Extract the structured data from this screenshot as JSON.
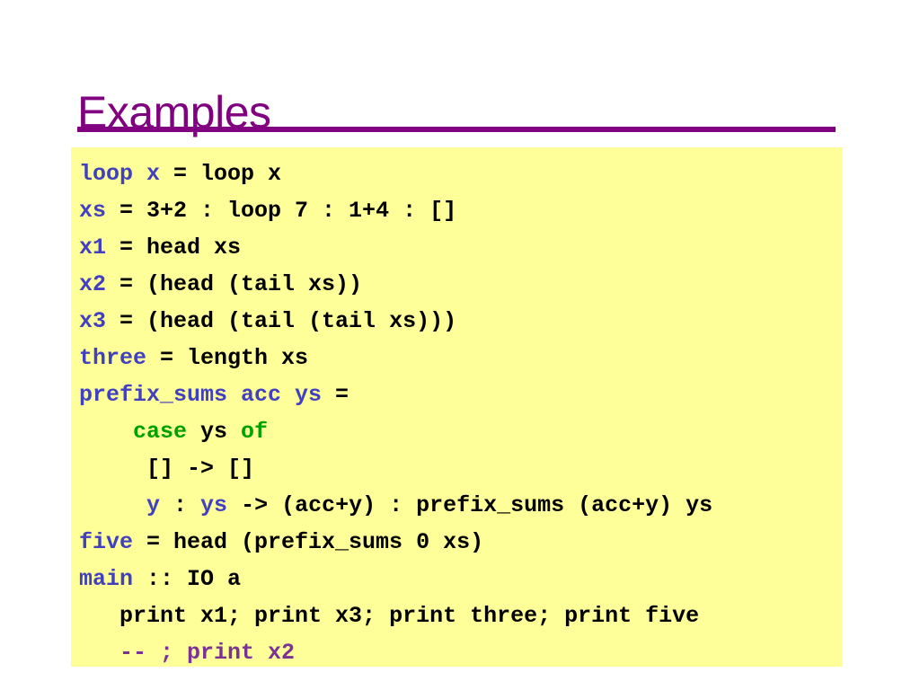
{
  "slide": {
    "title": "Examples",
    "accent_color": "#800080",
    "code_background": "#ffff99",
    "def_color": "#4040c0",
    "keyword_color": "#00a000",
    "comment_color": "#7b3294"
  },
  "code": {
    "lines": [
      {
        "indent": "",
        "tokens": [
          {
            "text": "loop x",
            "kind": "def"
          },
          {
            "text": " = loop x",
            "kind": "plain"
          }
        ]
      },
      {
        "indent": "",
        "tokens": [
          {
            "text": "xs",
            "kind": "def"
          },
          {
            "text": " = 3+2 : loop 7 : 1+4 : []",
            "kind": "plain"
          }
        ]
      },
      {
        "indent": "",
        "tokens": [
          {
            "text": "x1",
            "kind": "def"
          },
          {
            "text": " = head xs",
            "kind": "plain"
          }
        ]
      },
      {
        "indent": "",
        "tokens": [
          {
            "text": "x2",
            "kind": "def"
          },
          {
            "text": " = (head (tail xs))",
            "kind": "plain"
          }
        ]
      },
      {
        "indent": "",
        "tokens": [
          {
            "text": "x3",
            "kind": "def"
          },
          {
            "text": " = (head (tail (tail xs)))",
            "kind": "plain"
          }
        ]
      },
      {
        "indent": "",
        "tokens": [
          {
            "text": "three",
            "kind": "def"
          },
          {
            "text": " = length xs",
            "kind": "plain"
          }
        ]
      },
      {
        "indent": "",
        "tokens": [
          {
            "text": "prefix_sums acc ys",
            "kind": "def"
          },
          {
            "text": " =",
            "kind": "plain"
          }
        ]
      },
      {
        "indent": "    ",
        "tokens": [
          {
            "text": "case",
            "kind": "keyword"
          },
          {
            "text": " ys ",
            "kind": "plain"
          },
          {
            "text": "of",
            "kind": "keyword"
          }
        ]
      },
      {
        "indent": "     ",
        "tokens": [
          {
            "text": "[] -> []",
            "kind": "plain"
          }
        ]
      },
      {
        "indent": "     ",
        "tokens": [
          {
            "text": "y",
            "kind": "def"
          },
          {
            "text": " : ",
            "kind": "plain"
          },
          {
            "text": "ys",
            "kind": "def"
          },
          {
            "text": " -> (acc+y) : prefix_sums (acc+y) ys",
            "kind": "plain"
          }
        ]
      },
      {
        "indent": "",
        "tokens": [
          {
            "text": "five",
            "kind": "def"
          },
          {
            "text": " = head (prefix_sums 0 xs)",
            "kind": "plain"
          }
        ]
      },
      {
        "indent": "",
        "tokens": [
          {
            "text": "main",
            "kind": "def"
          },
          {
            "text": " :: IO a",
            "kind": "plain"
          }
        ]
      },
      {
        "indent": "   ",
        "tokens": [
          {
            "text": "print x1; print x3; print three; print five",
            "kind": "plain"
          }
        ]
      },
      {
        "indent": "   ",
        "tokens": [
          {
            "text": "-- ; print x2",
            "kind": "comment"
          }
        ]
      }
    ]
  }
}
